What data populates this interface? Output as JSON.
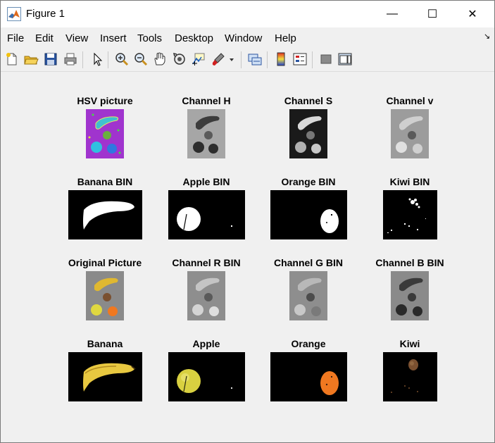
{
  "window": {
    "title": "Figure 1",
    "minimize_glyph": "—",
    "maximize_glyph": "☐",
    "close_glyph": "✕"
  },
  "menu": {
    "items": [
      "File",
      "Edit",
      "View",
      "Insert",
      "Tools",
      "Desktop",
      "Window",
      "Help"
    ],
    "dock_glyph": "↘"
  },
  "toolbar": {
    "icons": [
      "new-figure-icon",
      "open-file-icon",
      "save-icon",
      "print-icon",
      "select-arrow-icon",
      "zoom-in-icon",
      "zoom-out-icon",
      "pan-hand-icon",
      "rotate-3d-icon",
      "data-cursor-icon",
      "brush-icon",
      "brush-dropdown-icon",
      "link-plot-icon",
      "colorbar-icon",
      "legend-icon",
      "hide-plot-tools-icon",
      "show-plot-tools-icon"
    ]
  },
  "subplots": {
    "row1": [
      "HSV picture",
      "Channel H",
      "Channel S",
      "Channel v"
    ],
    "row2": [
      "Banana BIN",
      "Apple BIN",
      "Orange BIN",
      "Kiwi BIN"
    ],
    "row3": [
      "Original Picture",
      "Channel R BIN",
      "Channel G BIN",
      "Channel B BIN"
    ],
    "row4": [
      "Banana",
      "Apple",
      "Orange",
      "Kiwi"
    ]
  },
  "colors": {
    "titlebar_bg": "#ffffff",
    "chrome_bg": "#f0f0f0",
    "hsv_magenta": "#b030c8",
    "banana_yellow": "#e8c840",
    "apple_yellow": "#d8d040",
    "orange": "#f07820",
    "kiwi_brown": "#7a5030"
  }
}
